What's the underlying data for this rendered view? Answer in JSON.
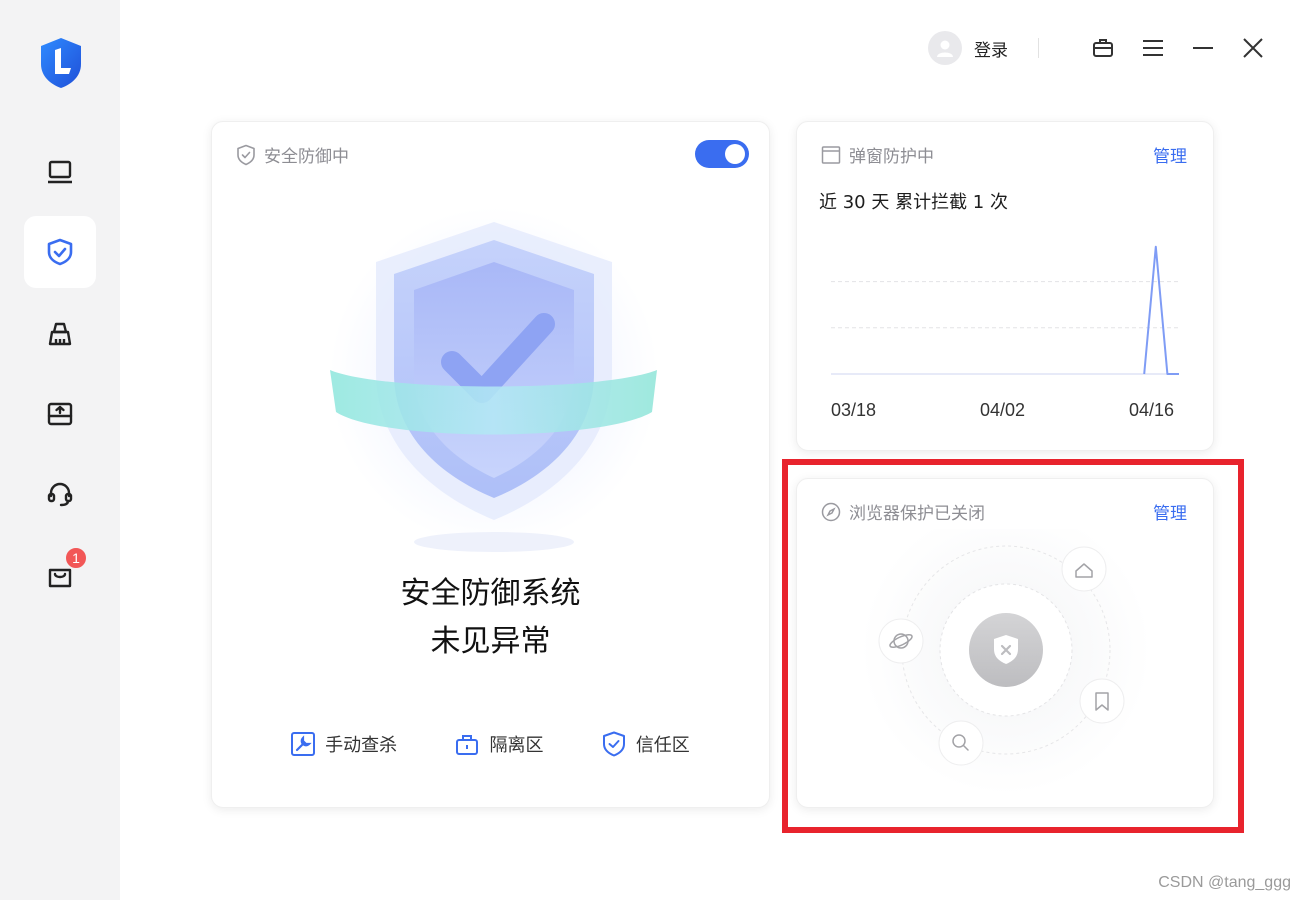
{
  "topbar": {
    "login_label": "登录"
  },
  "sidebar": {
    "cart_badge": "1"
  },
  "defense_card": {
    "title": "安全防御中",
    "toggle_on": true,
    "status_line1": "安全防御系统",
    "status_line2": "未见异常",
    "actions": [
      {
        "label": "手动查杀",
        "icon": "wrench-icon"
      },
      {
        "label": "隔离区",
        "icon": "lock-box-icon"
      },
      {
        "label": "信任区",
        "icon": "shield-check-icon"
      }
    ]
  },
  "popup_card": {
    "title": "弹窗防护中",
    "manage_label": "管理",
    "summary": "近 30 天 累计拦截 1 次",
    "chart_data": {
      "type": "line",
      "title": "",
      "x_tick_labels": [
        "03/18",
        "04/02",
        "04/16"
      ],
      "xlabel": "",
      "ylabel": "",
      "grid": true,
      "series": [
        {
          "values": [
            0,
            0,
            0,
            0,
            0,
            0,
            0,
            0,
            0,
            0,
            0,
            0,
            0,
            0,
            0,
            0,
            0,
            0,
            0,
            0,
            0,
            0,
            0,
            0,
            0,
            0,
            0,
            0,
            1,
            0,
            0
          ]
        }
      ],
      "ylim": [
        0,
        1.1
      ],
      "color": "#7f9cf5"
    }
  },
  "browser_card": {
    "title": "浏览器保护已关闭",
    "manage_label": "管理"
  },
  "watermark": "CSDN @tang_ggg",
  "colors": {
    "accent": "#3a6df0",
    "highlight": "#e8232d",
    "badge": "#f25757"
  }
}
